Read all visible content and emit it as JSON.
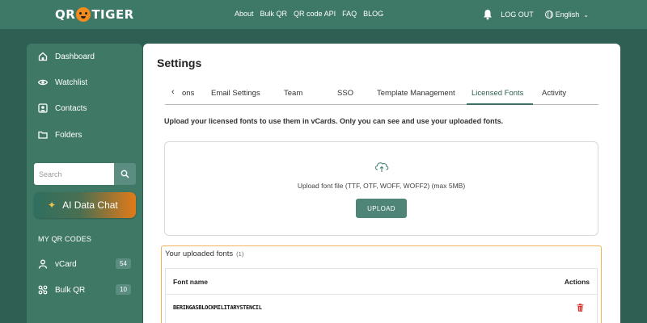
{
  "brand": {
    "logo_left": "QR",
    "logo_right": "TIGER"
  },
  "nav": {
    "items": [
      "About",
      "Bulk QR",
      "QR code API",
      "FAQ",
      "BLOG"
    ],
    "logout": "LOG OUT",
    "language": "English"
  },
  "sidebar": {
    "items": [
      {
        "label": "Dashboard",
        "icon": "home-icon"
      },
      {
        "label": "Watchlist",
        "icon": "eye-icon"
      },
      {
        "label": "Contacts",
        "icon": "contact-icon"
      },
      {
        "label": "Folders",
        "icon": "folder-icon"
      }
    ],
    "search_placeholder": "Search",
    "ai_button": "AI Data Chat",
    "section_label": "MY QR CODES",
    "qr_items": [
      {
        "label": "vCard",
        "count": "54",
        "icon": "person-icon"
      },
      {
        "label": "Bulk QR",
        "count": "10",
        "icon": "bulk-qr-icon"
      }
    ]
  },
  "main": {
    "title": "Settings",
    "tabs": [
      "ons",
      "Email Settings",
      "Team",
      "SSO",
      "Template Management",
      "Licensed Fonts",
      "Activity"
    ],
    "active_tab": "Licensed Fonts",
    "description": "Upload your licensed fonts to use them in vCards. Only you can see and use your uploaded fonts.",
    "upload": {
      "text": "Upload font file (TTF, OTF, WOFF, WOFF2) (max 5MB)",
      "button": "UPLOAD"
    },
    "fonts": {
      "heading": "Your uploaded fonts",
      "count": "(1)",
      "columns": {
        "name": "Font name",
        "actions": "Actions"
      },
      "rows": [
        {
          "name": "BERINGASBLOCKMILITARYSTENCIL"
        }
      ]
    }
  },
  "colors": {
    "background": "#2f5e52",
    "topbar": "#3e7866",
    "sidebar": "#3f7966",
    "accent_orange": "#e27a18",
    "primary_button": "#4e8577",
    "highlight_border": "#f0b25a",
    "delete_red": "#d9342b"
  }
}
